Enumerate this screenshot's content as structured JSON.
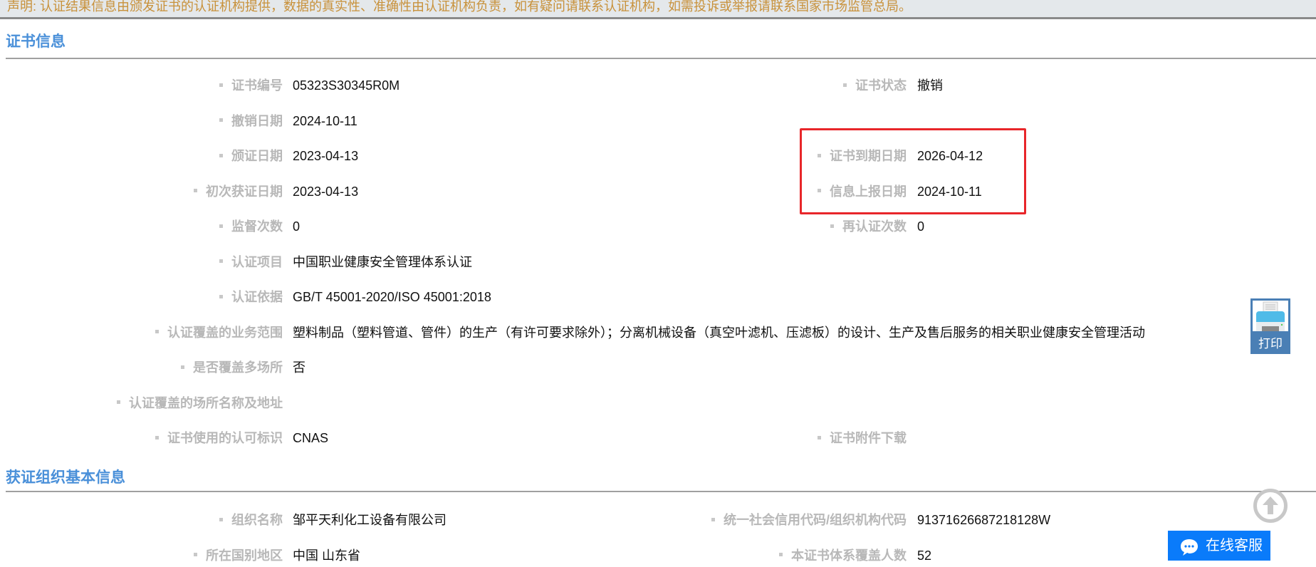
{
  "notice": "声明: 认证结果信息由颁发证书的认证机构提供，数据的真实性、准确性由认证机构负责，如有疑问请联系认证机构，如需投诉或举报请联系国家市场监管总局。",
  "cert_section": {
    "title": "证书信息",
    "rows": [
      {
        "label": "证书编号",
        "value": "05323S30345R0M",
        "rlabel": "证书状态",
        "rvalue": "撤销"
      },
      {
        "label": "撤销日期",
        "value": "2024-10-11"
      },
      {
        "label": "颁证日期",
        "value": "2023-04-13",
        "rlabel": "证书到期日期",
        "rvalue": "2026-04-12"
      },
      {
        "label": "初次获证日期",
        "value": "2023-04-13",
        "rlabel": "信息上报日期",
        "rvalue": "2024-10-11"
      },
      {
        "label": "监督次数",
        "value": "0",
        "rlabel": "再认证次数",
        "rvalue": "0"
      },
      {
        "label": "认证项目",
        "value": "中国职业健康安全管理体系认证"
      },
      {
        "label": "认证依据",
        "value": "GB/T 45001-2020/ISO 45001:2018"
      },
      {
        "label": "认证覆盖的业务范围",
        "value": "塑料制品（塑料管道、管件）的生产（有许可要求除外）；分离机械设备（真空叶滤机、压滤板）的设计、生产及售后服务的相关职业健康安全管理活动"
      },
      {
        "label": "是否覆盖多场所",
        "value": "否"
      },
      {
        "label": "认证覆盖的场所名称及地址",
        "value": ""
      },
      {
        "label": "证书使用的认可标识",
        "value": "CNAS",
        "rlabel": "证书附件下载",
        "rvalue": ""
      }
    ]
  },
  "org_section": {
    "title": "获证组织基本信息",
    "rows": [
      {
        "label": "组织名称",
        "value": "邹平天利化工设备有限公司",
        "rlabel": "统一社会信用代码/组织机构代码",
        "rvalue": "91371626687218128W"
      },
      {
        "label": "所在国别地区",
        "value": "中国 山东省",
        "rlabel": "本证书体系覆盖人数",
        "rvalue": "52"
      }
    ]
  },
  "print_button": {
    "label": "打印",
    "icon": "printer-icon"
  },
  "back_to_top": {
    "icon": "arrow-up-circle-icon"
  },
  "online_service": {
    "label": "在线客服",
    "icon": "chat-bubble-icon"
  },
  "colors": {
    "heading": "#4a90d9",
    "highlight_box": "#e8262a",
    "service": "#0a7bfa",
    "notice_text": "#c8913a"
  }
}
